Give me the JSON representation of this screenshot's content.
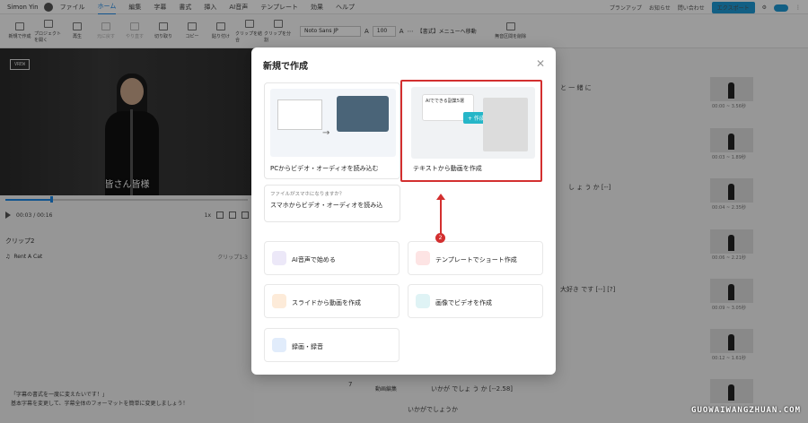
{
  "topbar": {
    "user": "Simon Yin",
    "menu": [
      "ファイル",
      "ホーム",
      "編集",
      "字幕",
      "書式",
      "挿入",
      "AI音声",
      "テンプレート",
      "効果",
      "ヘルプ"
    ],
    "active_index": 1,
    "plan": "プランアップ",
    "notice": "お知らせ",
    "contact": "問い合わせ",
    "export": "エクスポート"
  },
  "toolbar": {
    "tools": [
      {
        "label": "新規で作成",
        "dim": false
      },
      {
        "label": "プロジェクトを開く",
        "dim": false
      },
      {
        "label": "再生",
        "dim": false
      },
      {
        "label": "元に戻す",
        "dim": true
      },
      {
        "label": "やり直す",
        "dim": true
      },
      {
        "label": "切り取り",
        "dim": false
      },
      {
        "label": "コピー",
        "dim": false
      },
      {
        "label": "貼り付け",
        "dim": false
      },
      {
        "label": "クリップを結合",
        "dim": false
      },
      {
        "label": "クリップを分割",
        "dim": false
      }
    ],
    "font": "Noto Sans JP",
    "font_size": "100",
    "menu_move": "【書式】メニューへ移動",
    "silence": "無音区間を削除"
  },
  "video": {
    "logo": "VREW",
    "subtitle": "皆さん皆様",
    "time_current": "00:03",
    "time_total": "00:16",
    "speed": "1x"
  },
  "clip": {
    "header": "クリップ2",
    "row_label": "Rent A Cat",
    "row_right": "クリップ1-3"
  },
  "tip": {
    "title": "「字幕の書式を一度に変えたいです！」",
    "body": "基本字幕を変更して、字幕全体のフォーマットを簡単に変更しましょう！"
  },
  "transcript": {
    "rows": [
      {
        "text": "と 一 緒 に",
        "time": "00:00 ~ 3.56秒"
      },
      {
        "text": "",
        "time": "00:03 ~ 1.89秒"
      },
      {
        "text": "し ょ う か [--]",
        "time": "00:04 ~ 2.35秒"
      },
      {
        "text": "",
        "time": "00:06 ~ 2.21秒"
      },
      {
        "text": "大好き です [--] [?]",
        "time": "00:09 ~ 3.05秒"
      },
      {
        "text": "",
        "time": "00:12 ~ 1.61秒"
      },
      {
        "text": "いかが でしょ う か [--2.58]",
        "time": ""
      }
    ],
    "row7_num": "7",
    "row7_label": "動画編集",
    "row7_sub": "いかがでしょうか"
  },
  "modal": {
    "title": "新規で作成",
    "pc_label": "PCからビデオ・オーディオを読み込む",
    "ai_label": "テキストから動画を作成",
    "ai_chip": "AIでできる副業5選",
    "ai_create": "+ 作成",
    "phone_hint": "ファイルがスマホになりますか？",
    "phone_label": "スマホからビデオ・オーディオを読み込",
    "options": [
      {
        "label": "AI音声で始める",
        "color": "#ece8f8"
      },
      {
        "label": "テンプレートでショート作成",
        "color": "#fde4e4"
      },
      {
        "label": "スライドから動画を作成",
        "color": "#fdebd9"
      },
      {
        "label": "画像でビデオを作成",
        "color": "#dff3f5"
      },
      {
        "label": "録画・録音",
        "color": "#e1ecfb"
      }
    ],
    "step_badge": "2"
  },
  "watermark": "GUOWAIWANGZHUAN.COM"
}
